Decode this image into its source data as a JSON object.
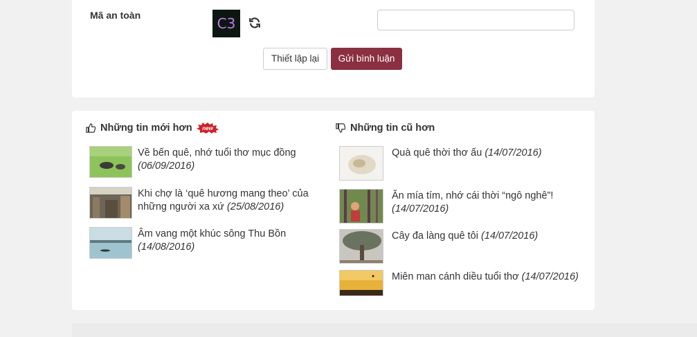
{
  "captcha": {
    "label": "Mã an toàn",
    "image_text": "C3",
    "input_value": "",
    "input_placeholder": ""
  },
  "buttons": {
    "reset": "Thiết lập lại",
    "submit": "Gửi bình luận"
  },
  "newer": {
    "heading": "Những tin mới hơn",
    "badge": "new",
    "items": [
      {
        "title": "Về bến quê, nhớ tuổi thơ mục đồng",
        "date": "(06/09/2016)"
      },
      {
        "title": "Khi chợ là ‘quê hương mang theo’ của những người xa xứ",
        "date": "(25/08/2016)"
      },
      {
        "title": "Âm vang một khúc sông Thu Bồn",
        "date": "(14/08/2016)"
      }
    ]
  },
  "older": {
    "heading": "Những tin cũ hơn",
    "items": [
      {
        "title": "Quà quê thời thơ ấu",
        "date": "(14/07/2016)"
      },
      {
        "title": "Ăn mía tím, nhớ cái thời “ngô nghê”!",
        "date": "(14/07/2016)"
      },
      {
        "title": "Cây đa làng quê tôi",
        "date": "(14/07/2016)"
      },
      {
        "title": "Miên man cánh diều tuổi thơ",
        "date": "(14/07/2016)"
      }
    ]
  },
  "colors": {
    "submit_bg": "#8a3040",
    "badge": "#d0202a",
    "captcha_bg": "#0b1710",
    "captcha_text": "#c07ae8"
  }
}
